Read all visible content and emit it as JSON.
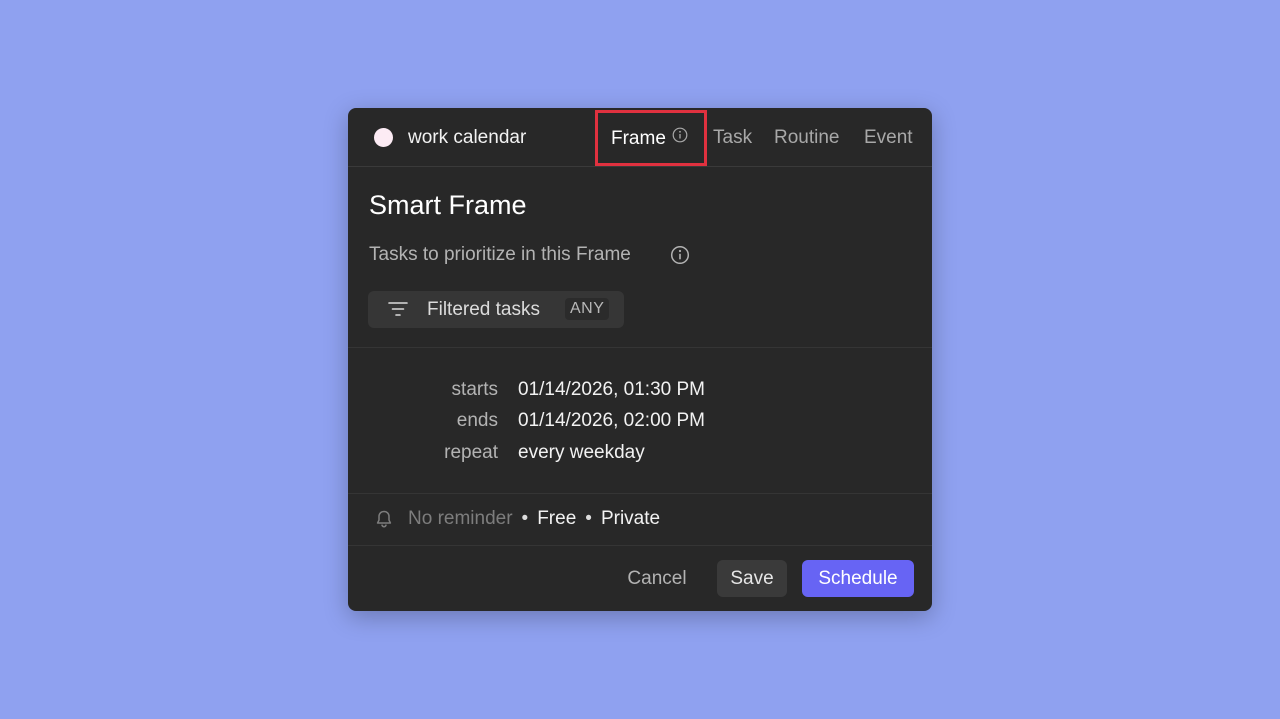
{
  "header": {
    "calendar_name": "work calendar",
    "calendar_color": "#fcebf4",
    "tabs": [
      {
        "label": "Frame",
        "selected": true
      },
      {
        "label": "Task",
        "selected": false
      },
      {
        "label": "Routine",
        "selected": false
      },
      {
        "label": "Event",
        "selected": false
      }
    ]
  },
  "main": {
    "title": "Smart Frame",
    "subtitle": "Tasks to prioritize in this Frame",
    "filter": {
      "label": "Filtered tasks",
      "badge": "ANY"
    }
  },
  "schedule": {
    "rows": [
      {
        "label": "starts",
        "value": "01/14/2026, 01:30 PM"
      },
      {
        "label": "ends",
        "value": "01/14/2026, 02:00 PM"
      },
      {
        "label": "repeat",
        "value": "every weekday"
      }
    ]
  },
  "footer": {
    "reminder": "No reminder",
    "availability": "Free",
    "visibility": "Private",
    "separator": "•"
  },
  "actions": {
    "cancel": "Cancel",
    "save": "Save",
    "schedule": "Schedule"
  },
  "colors": {
    "background": "#8fa1f0",
    "dialog": "#282828",
    "accent": "#6764f4",
    "highlight": "#e0313f"
  },
  "icons": [
    "info-icon",
    "filter-icon",
    "bell-icon"
  ]
}
